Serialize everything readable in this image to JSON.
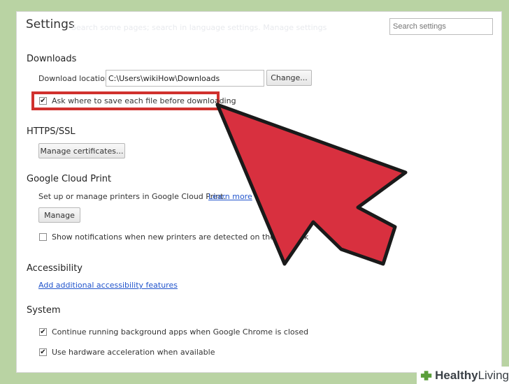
{
  "header": {
    "title": "Settings",
    "ghost_text": "Search some pages; search in language settings. Manage settings",
    "search_placeholder": "Search settings"
  },
  "downloads": {
    "heading": "Downloads",
    "location_label": "Download location:",
    "location_value": "C:\\Users\\wikiHow\\Downloads",
    "change_button": "Change...",
    "ask_label": "Ask where to save each file before downloading",
    "ask_checked": true
  },
  "https": {
    "heading": "HTTPS/SSL",
    "manage_certs_button": "Manage certificates..."
  },
  "cloud_print": {
    "heading": "Google Cloud Print",
    "description": "Set up or manage printers in Google Cloud Print.",
    "learn_more": "Learn more",
    "manage_button": "Manage",
    "notify_label": "Show notifications when new printers are detected on the network",
    "notify_checked": false
  },
  "accessibility": {
    "heading": "Accessibility",
    "link": "Add additional accessibility features"
  },
  "system": {
    "heading": "System",
    "background_apps_label": "Continue running background apps when Google Chrome is closed",
    "background_apps_checked": true,
    "hw_accel_label": "Use hardware acceleration when available",
    "hw_accel_checked": true
  },
  "overlay": {
    "highlight_color": "#d0312e",
    "arrow_color": "#d8303f"
  },
  "watermark": {
    "brand_strong": "Healthy",
    "brand_light": "Living"
  }
}
